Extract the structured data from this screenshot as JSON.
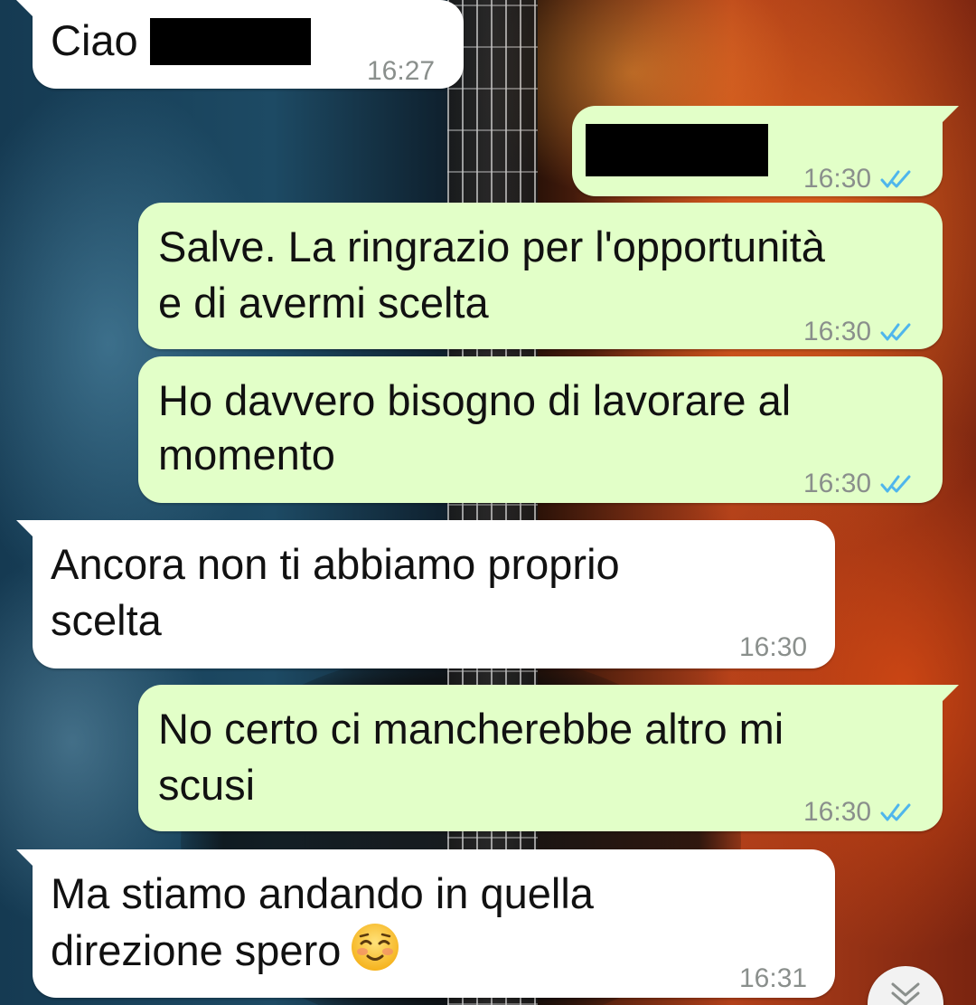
{
  "wallpaper": {
    "accent_left": "#1d4a64",
    "accent_right": "#b2401a"
  },
  "colors": {
    "incoming_bubble": "#ffffff",
    "outgoing_bubble": "#e2ffc8",
    "read_ticks": "#4fb6ec",
    "timestamp": "#8a8f8c"
  },
  "messages": [
    {
      "direction": "incoming",
      "lines": [
        "Ciao"
      ],
      "time": "16:27",
      "redacted": true
    },
    {
      "direction": "outgoing",
      "lines": [],
      "time": "16:30",
      "status": "read",
      "redacted": true
    },
    {
      "direction": "outgoing",
      "lines": [
        "Salve. La ringrazio per l'opportunità",
        "e di avermi scelta"
      ],
      "time": "16:30",
      "status": "read"
    },
    {
      "direction": "outgoing",
      "lines": [
        "Ho davvero bisogno di lavorare al",
        "momento"
      ],
      "time": "16:30",
      "status": "read"
    },
    {
      "direction": "incoming",
      "lines": [
        "Ancora non ti abbiamo proprio",
        "scelta"
      ],
      "time": "16:30"
    },
    {
      "direction": "outgoing",
      "lines": [
        "No certo ci mancherebbe altro mi",
        "scusi"
      ],
      "time": "16:30",
      "status": "read"
    },
    {
      "direction": "incoming",
      "lines": [
        "Ma stiamo andando in quella",
        "direzione spero"
      ],
      "time": "16:31",
      "emoji": "smiling-face-icon"
    }
  ],
  "scroll_button": {
    "icon": "double-chevron-down-icon"
  }
}
